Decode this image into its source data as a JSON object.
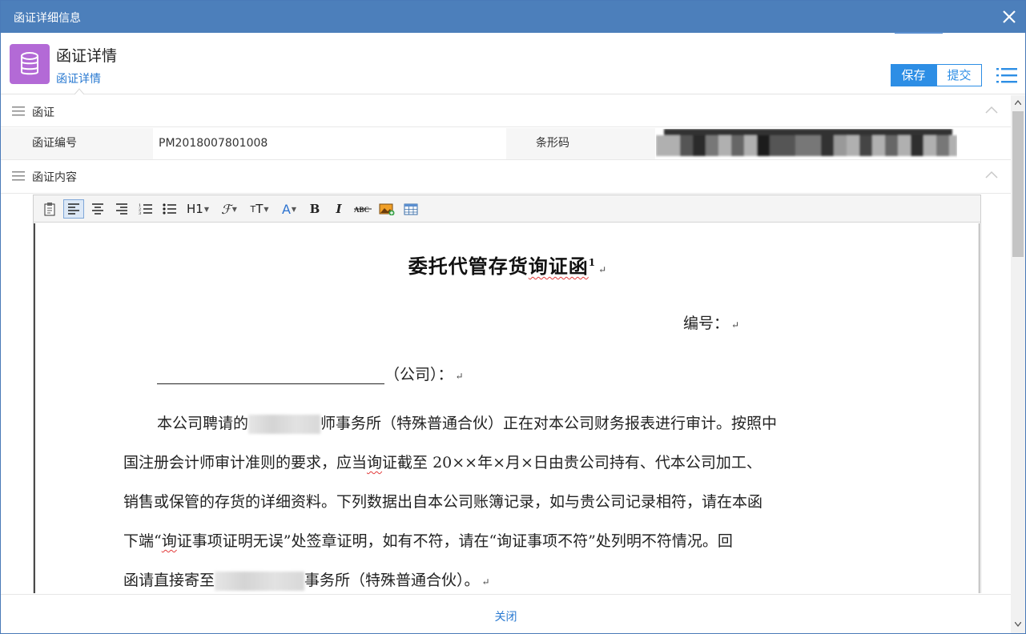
{
  "window": {
    "title": "函证详细信息"
  },
  "header": {
    "title": "函证详情",
    "tab": "函证详情",
    "save_label": "保存",
    "submit_label": "提交"
  },
  "section1": {
    "label": "函证",
    "field1_label": "函证编号",
    "field1_value": "PM2018007801008",
    "field2_label": "条形码"
  },
  "section2": {
    "label": "函证内容"
  },
  "toolbar": {
    "heading_label": "H1"
  },
  "document": {
    "title": "委托代管存货",
    "title_squiggle": "询证函",
    "title_sup": "1",
    "number_label": "编号：",
    "company_line_suffix": "（公司）：",
    "p1_a": "本公司聘请的",
    "p1_b": "师事务所（特殊普通合伙）正在对本公司财务报表进行审计。按照中",
    "p2_a": "国注册会计师审计准则的要求，应当",
    "p2_sq": "询",
    "p2_b": "证截至 20××年×月×日由贵公司持有、代本公司加工、",
    "p3": "销售或保管的存货的详细资料。下列数据出自本公司账簿记录，如与贵公司记录相符，请在本函",
    "p4_a": "下端“",
    "p4_sq": "询",
    "p4_b": "证事项证明无误”处签章证明，如有不符，请在“询证事项不符”处列明不符情况。回",
    "p5_a": "函请直接寄至",
    "p5_b": "事务所（特殊普通合伙）。"
  },
  "footer": {
    "close_label": "关闭"
  },
  "colors": {
    "titlebar": "#4c7fbb",
    "accent": "#2d8ee5",
    "app_icon": "#b36ad6",
    "link": "#2a7ad1"
  },
  "icons": {
    "app": "database-icon",
    "close": "close-icon",
    "menu": "list-icon"
  }
}
